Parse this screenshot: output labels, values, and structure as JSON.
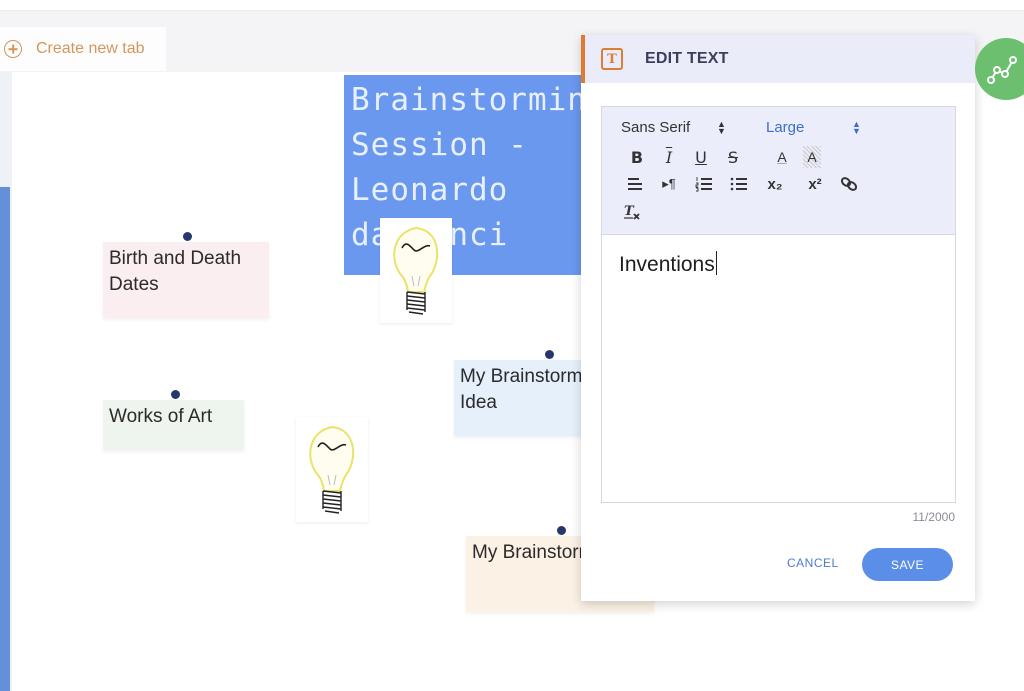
{
  "tab_bar": {
    "create_new_tab_label": "Create new tab",
    "create_icon": "plus-circle-icon"
  },
  "canvas": {
    "title_card": {
      "text": "Brainstorming\nSession -\nLeonardo\nda Vinci",
      "color": "#6a98ef"
    },
    "sticky_notes": [
      {
        "text": "Birth and Death Dates",
        "color": "#fbeef0"
      },
      {
        "text": "Works of Art",
        "color": "#eef4ee"
      },
      {
        "text": "My Brainstorm Idea",
        "color": "#e6f0fb"
      },
      {
        "text": "My Brainstorm Idea",
        "color": "#fbf1e4"
      }
    ],
    "images": [
      {
        "icon": "lightbulb-icon"
      },
      {
        "icon": "lightbulb-icon"
      }
    ]
  },
  "dialog": {
    "title": "EDIT TEXT",
    "title_icon": "text-format-icon",
    "toolbar": {
      "font_family": "Sans Serif",
      "font_size": "Large",
      "buttons": {
        "bold": "B",
        "italic": "I",
        "underline": "U",
        "strike": "S",
        "font_color": "A",
        "background_color": "A",
        "align": "align-icon",
        "direction": "▸¶",
        "ordered_list": "ordered-list-icon",
        "bullet_list": "bullet-list-icon",
        "subscript": "x₂",
        "superscript": "x²",
        "link": "link-icon",
        "clear_format": "clear-format-icon"
      }
    },
    "content": "Inventions",
    "char_count": "11/2000",
    "cancel_label": "CANCEL",
    "save_label": "SAVE",
    "accent_color": "#e07a2e",
    "save_color": "#5b8ee8"
  },
  "fab": {
    "icon": "graph-nodes-icon",
    "color": "#6bbf6e"
  }
}
